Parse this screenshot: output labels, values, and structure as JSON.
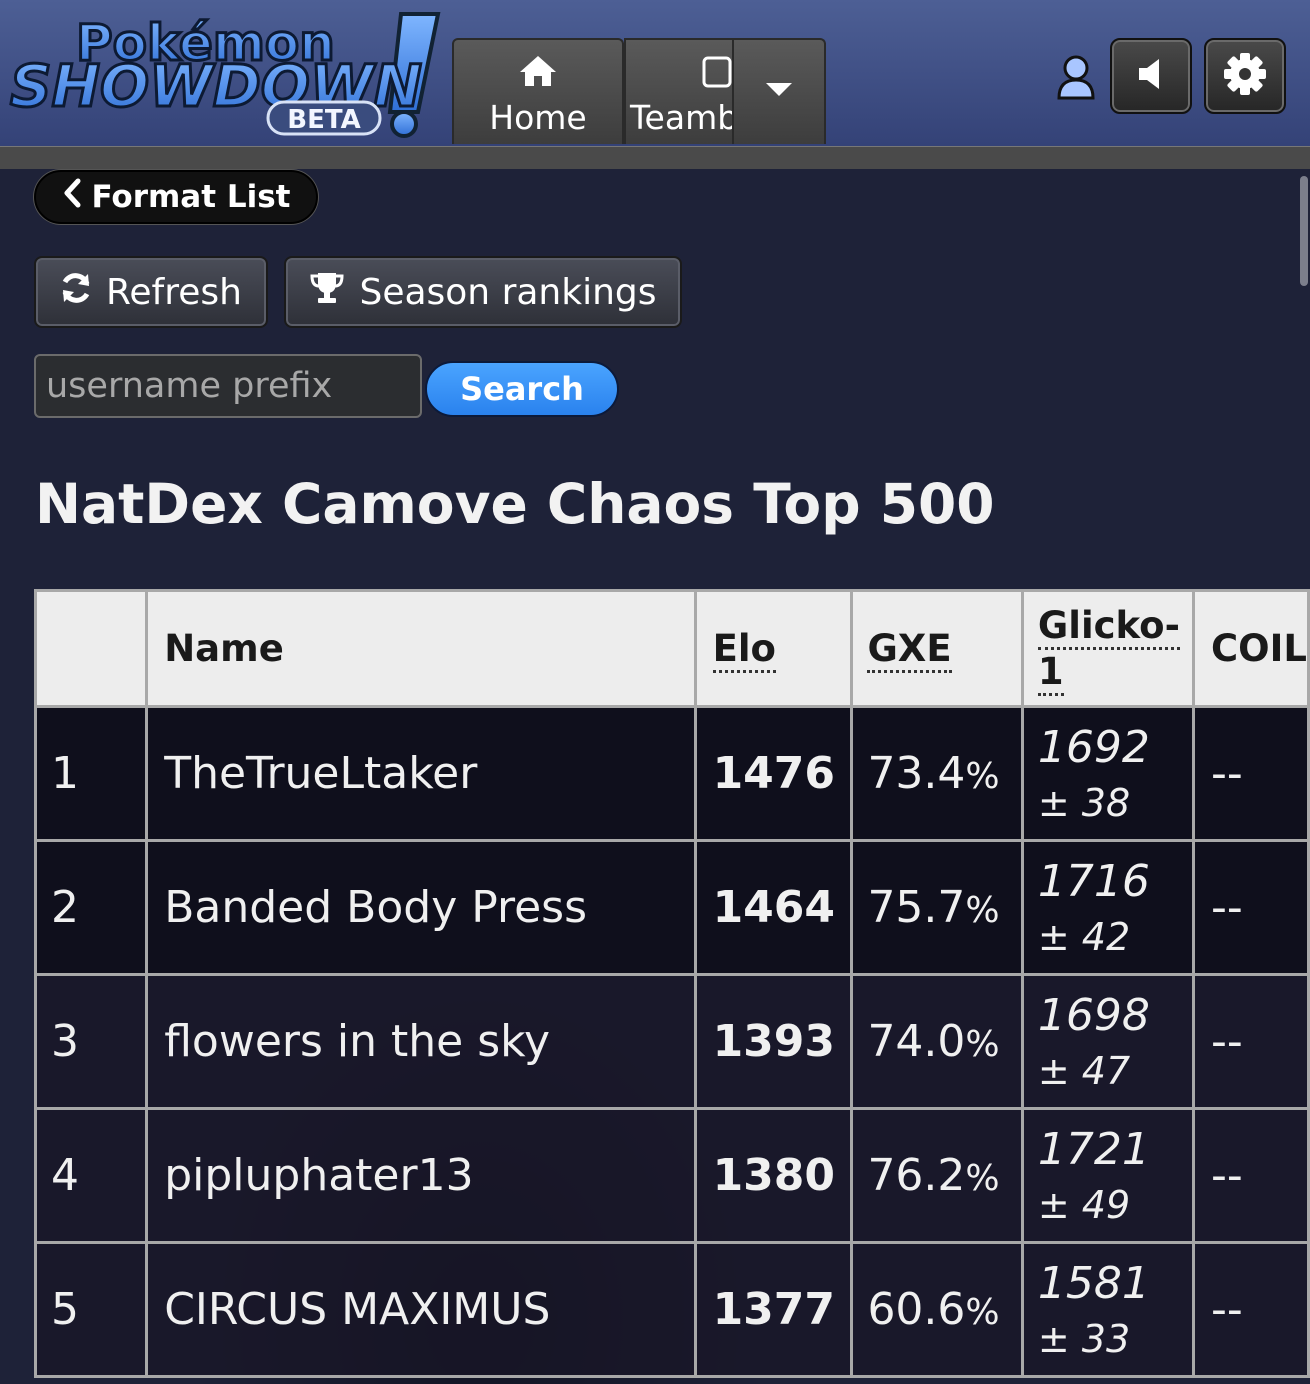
{
  "header": {
    "logo_text_top": "Pokémon",
    "logo_text_main": "SHOWDOWN!",
    "logo_badge": "BETA",
    "tabs": [
      {
        "label": "Home",
        "icon": "home-icon"
      },
      {
        "label": "Teambuilder",
        "icon": "edit-icon"
      }
    ],
    "more_icon": "caret-down-icon",
    "user_icon": "user-icon",
    "sound_icon": "volume-icon",
    "settings_icon": "gear-icon"
  },
  "nav": {
    "format_list_label": "Format List",
    "refresh_label": "Refresh",
    "season_label": "Season rankings",
    "search_placeholder": "username prefix",
    "search_button": "Search"
  },
  "ladder": {
    "title": "NatDex Camove Chaos Top 500",
    "columns": [
      "",
      "Name",
      "Elo",
      "GXE",
      "Glicko-1",
      "COIL"
    ],
    "rows": [
      {
        "rank": "1",
        "name": "TheTrueLtaker",
        "elo": "1476",
        "gxe": "73.4",
        "gxe_unit": "%",
        "glicko": "1692",
        "glicko_dev": "± 38",
        "coil": "--"
      },
      {
        "rank": "2",
        "name": "Banded Body Press",
        "elo": "1464",
        "gxe": "75.7",
        "gxe_unit": "%",
        "glicko": "1716",
        "glicko_dev": "± 42",
        "coil": "--"
      },
      {
        "rank": "3",
        "name": "flowers in the sky",
        "elo": "1393",
        "gxe": "74.0",
        "gxe_unit": "%",
        "glicko": "1698",
        "glicko_dev": "± 47",
        "coil": "--"
      },
      {
        "rank": "4",
        "name": "pipluphater13",
        "elo": "1380",
        "gxe": "76.2",
        "gxe_unit": "%",
        "glicko": "1721",
        "glicko_dev": "± 49",
        "coil": "--"
      },
      {
        "rank": "5",
        "name": "CIRCUS MAXIMUS",
        "elo": "1377",
        "gxe": "60.6",
        "gxe_unit": "%",
        "glicko": "1581",
        "glicko_dev": "± 33",
        "coil": "--"
      }
    ]
  },
  "colors": {
    "header_top": "#4d5f95",
    "background": "#1e2238",
    "search_blue": "#2a82ee"
  }
}
